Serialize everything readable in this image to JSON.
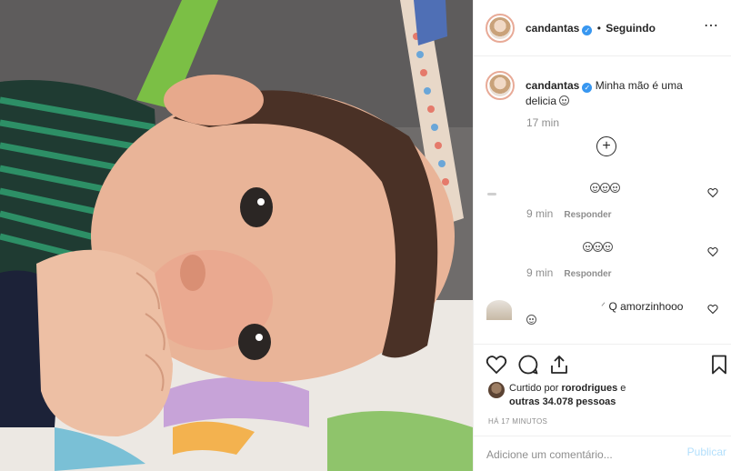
{
  "post": {
    "image_description_icon": "photo"
  },
  "header": {
    "username": "candantas",
    "separator": "•",
    "follow_status": "Seguindo",
    "more_icon": "⋯",
    "verified_icon": "✓"
  },
  "caption": {
    "username": "candantas",
    "text": "Minha mão é uma delicia",
    "time": "17 min"
  },
  "load_more_icon": "+",
  "comments": [
    {
      "text": "",
      "time": "9 min",
      "reply_label": "Responder"
    },
    {
      "text": "",
      "time": "9 min",
      "reply_label": "Responder"
    },
    {
      "text": "Q amorzinhooo",
      "time": "",
      "reply_label": ""
    }
  ],
  "likes": {
    "prefix": "Curtido por",
    "user": "rorodrigues",
    "connector": "e",
    "others": "outras 34.078 pessoas"
  },
  "post_time": "HÁ 17 MINUTOS",
  "add_comment": {
    "placeholder": "Adicione um comentário...",
    "publish_label": "Publicar"
  },
  "colors": {
    "accent_blue": "#3897f0",
    "publish_disabled": "#b2dffc",
    "secondary_text": "#8e8e8e"
  }
}
